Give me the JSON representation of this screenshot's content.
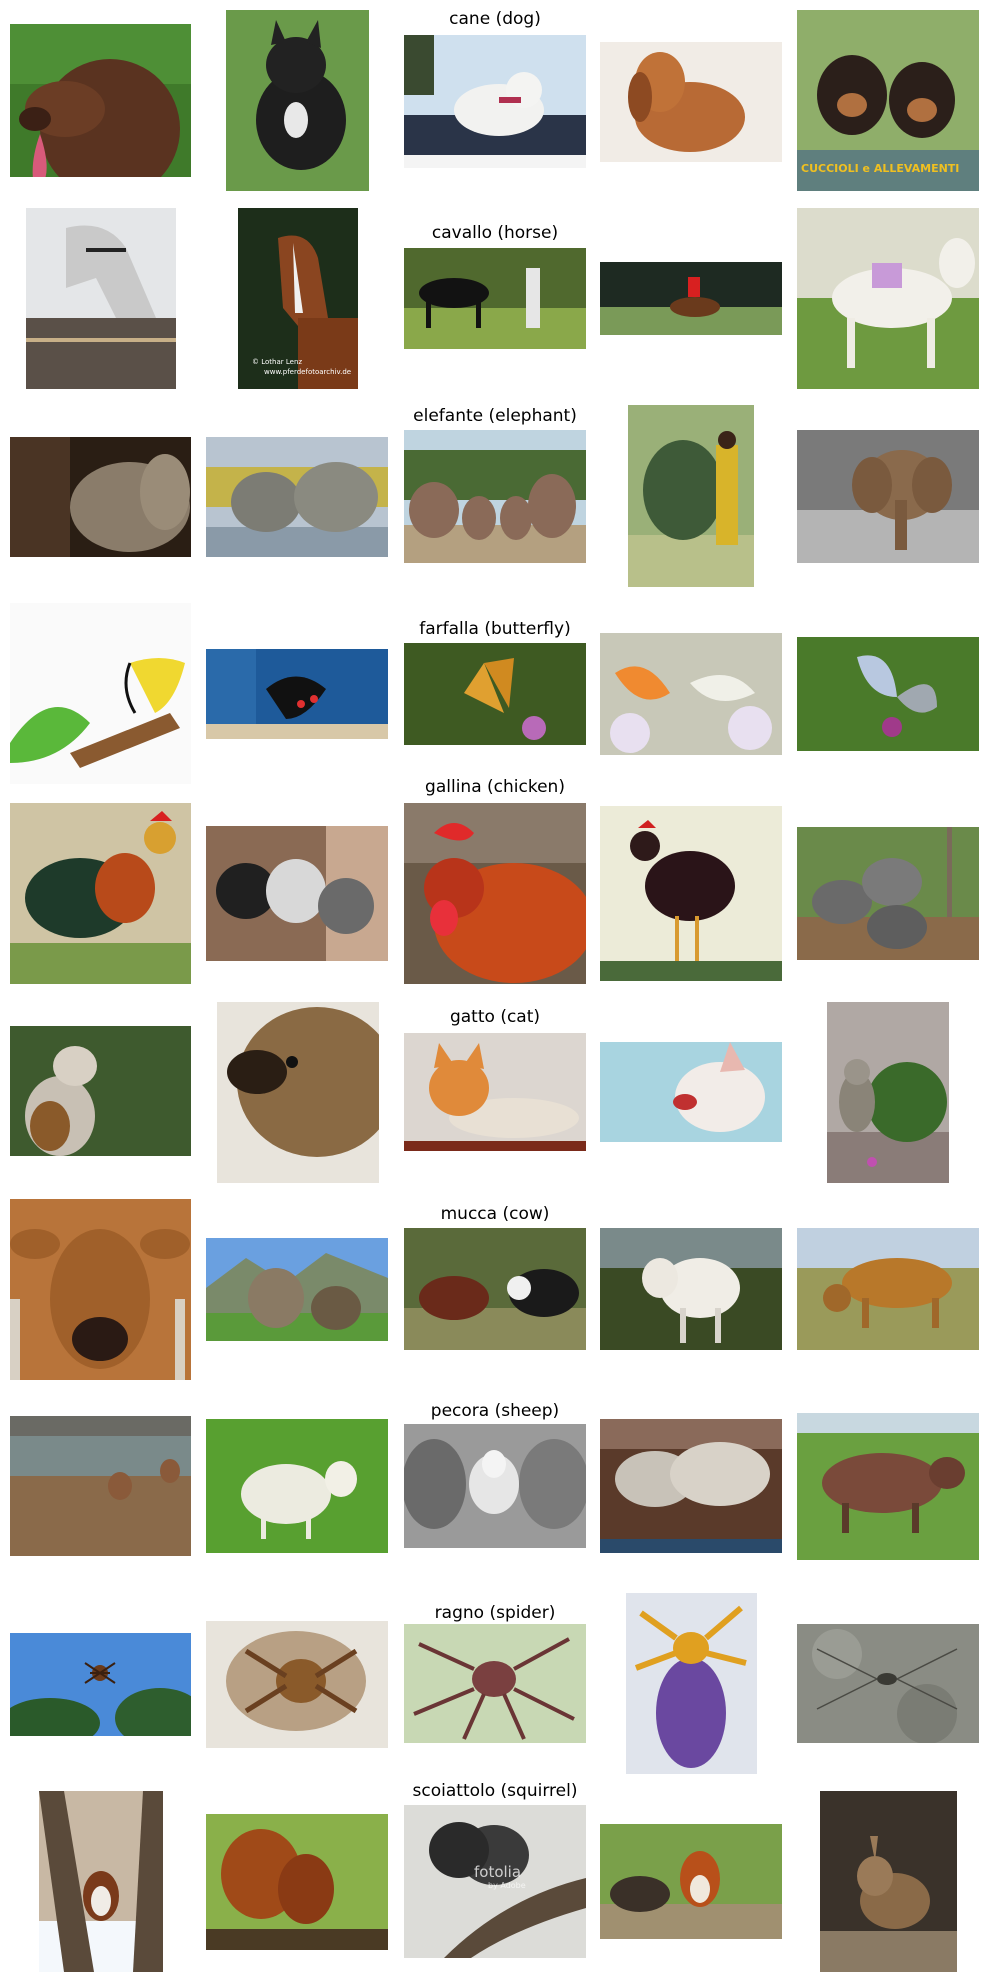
{
  "rows": [
    {
      "title": "cane (dog)"
    },
    {
      "title": "cavallo (horse)"
    },
    {
      "title": "elefante (elephant)"
    },
    {
      "title": "farfalla (butterfly)"
    },
    {
      "title": "gallina (chicken)"
    },
    {
      "title": "gatto (cat)"
    },
    {
      "title": "mucca (cow)"
    },
    {
      "title": "pecora (sheep)"
    },
    {
      "title": "ragno (spider)"
    },
    {
      "title": "scoiattolo (squirrel)"
    }
  ],
  "overlays": {
    "cuccioli": "CUCCIOLI e ALLEVAMENTI",
    "lothar_line1": "©  Lothar Lenz",
    "lothar_line2": "www.pferdefotoarchiv.de",
    "fotolia": "fotolia",
    "fotolia_by": "by Adobe"
  }
}
